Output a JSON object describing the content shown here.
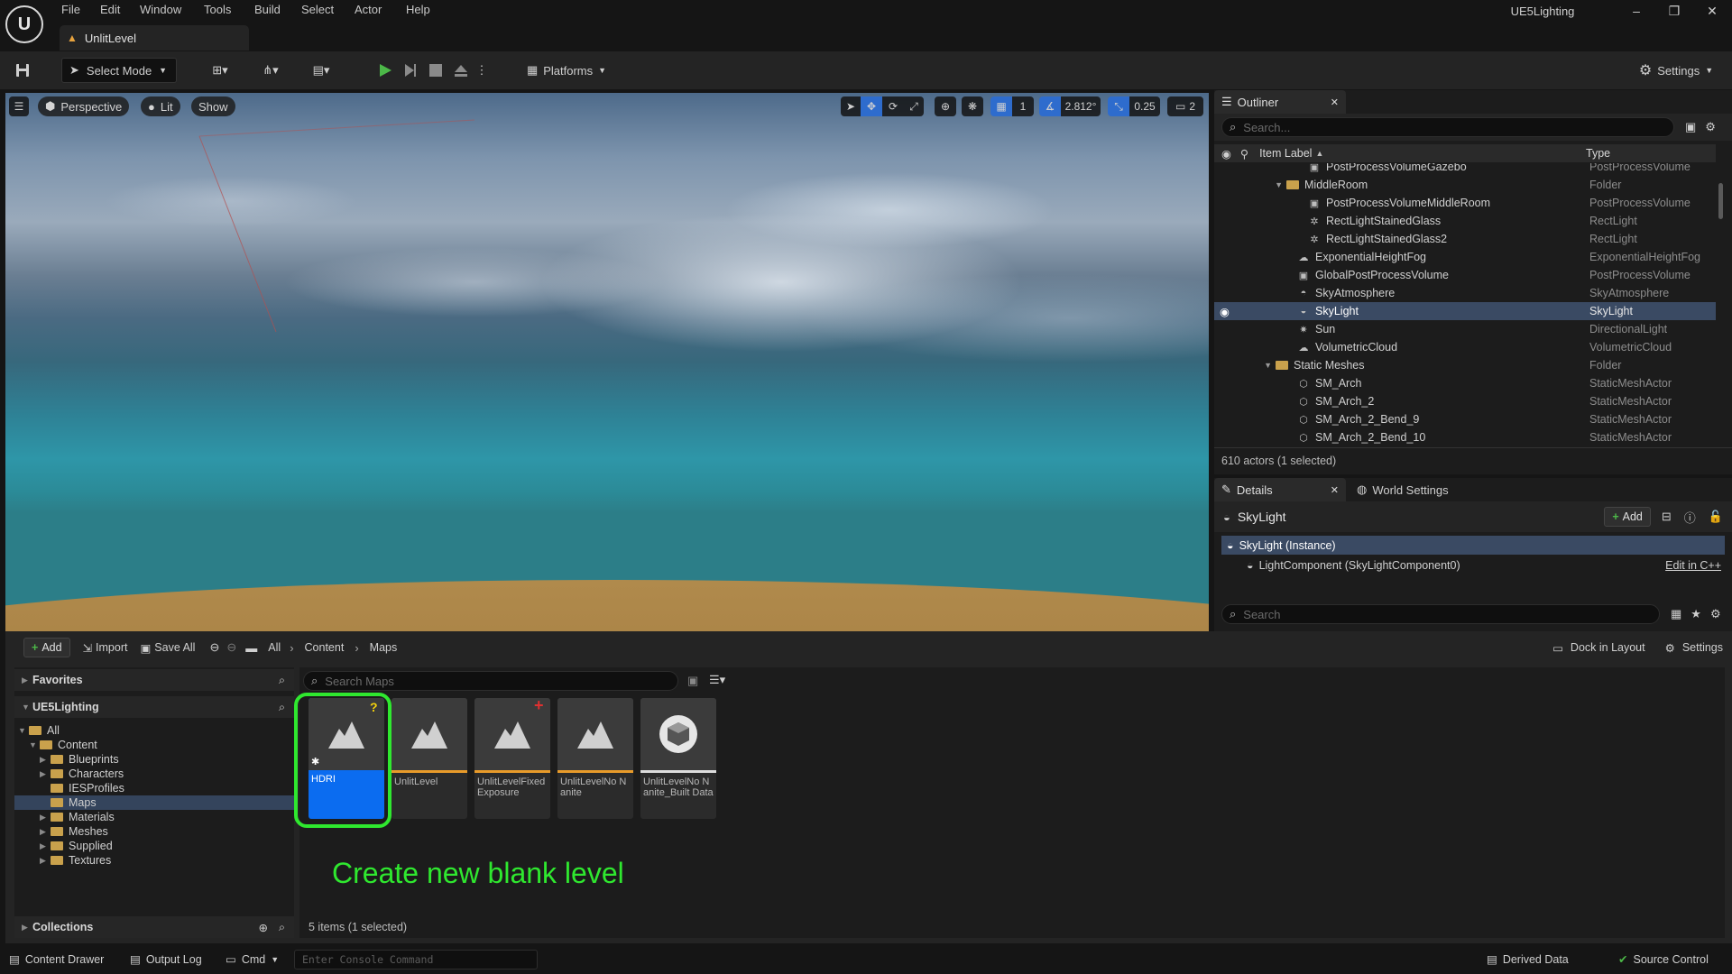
{
  "menu": [
    "File",
    "Edit",
    "Window",
    "Tools",
    "Build",
    "Select",
    "Actor",
    "Help"
  ],
  "level_tab": "UnlitLevel",
  "project_name": "UE5Lighting",
  "toolbar": {
    "select_mode": "Select Mode",
    "platforms": "Platforms",
    "settings": "Settings"
  },
  "viewport": {
    "perspective": "Perspective",
    "lit": "Lit",
    "show": "Show",
    "grid_value": "1",
    "angle_value": "2.812°",
    "scale_value": "0.25",
    "camera_speed": "2"
  },
  "outliner": {
    "title": "Outliner",
    "search_placeholder": "Search...",
    "col_label": "Item Label",
    "col_type": "Type",
    "rows": [
      {
        "label": "PostProcessVolumeGazebo",
        "type": "PostProcessVolume"
      },
      {
        "label": "MiddleRoom",
        "type": "Folder"
      },
      {
        "label": "PostProcessVolumeMiddleRoom",
        "type": "PostProcessVolume"
      },
      {
        "label": "RectLightStainedGlass",
        "type": "RectLight"
      },
      {
        "label": "RectLightStainedGlass2",
        "type": "RectLight"
      },
      {
        "label": "ExponentialHeightFog",
        "type": "ExponentialHeightFog"
      },
      {
        "label": "GlobalPostProcessVolume",
        "type": "PostProcessVolume"
      },
      {
        "label": "SkyAtmosphere",
        "type": "SkyAtmosphere"
      },
      {
        "label": "SkyLight",
        "type": "SkyLight"
      },
      {
        "label": "Sun",
        "type": "DirectionalLight"
      },
      {
        "label": "VolumetricCloud",
        "type": "VolumetricCloud"
      },
      {
        "label": "Static Meshes",
        "type": "Folder"
      },
      {
        "label": "SM_Arch",
        "type": "StaticMeshActor"
      },
      {
        "label": "SM_Arch_2",
        "type": "StaticMeshActor"
      },
      {
        "label": "SM_Arch_2_Bend_9",
        "type": "StaticMeshActor"
      },
      {
        "label": "SM_Arch_2_Bend_10",
        "type": "StaticMeshActor"
      }
    ],
    "footer": "610 actors (1 selected)"
  },
  "details": {
    "tab": "Details",
    "world_settings": "World Settings",
    "actor_name": "SkyLight",
    "add_label": "Add",
    "instance": "SkyLight (Instance)",
    "component": "LightComponent (SkyLightComponent0)",
    "edit_cpp": "Edit in C++",
    "search_placeholder": "Search"
  },
  "content_browser": {
    "add": "Add",
    "import": "Import",
    "save_all": "Save All",
    "breadcrumb": [
      "All",
      "Content",
      "Maps"
    ],
    "dock": "Dock in Layout",
    "settings": "Settings",
    "favorites": "Favorites",
    "project": "UE5Lighting",
    "collections": "Collections",
    "tree": [
      {
        "label": "All",
        "depth": 0,
        "expanded": true
      },
      {
        "label": "Content",
        "depth": 1,
        "expanded": true
      },
      {
        "label": "Blueprints",
        "depth": 2,
        "expanded": false
      },
      {
        "label": "Characters",
        "depth": 2,
        "expanded": false
      },
      {
        "label": "IESProfiles",
        "depth": 2,
        "expanded": null
      },
      {
        "label": "Maps",
        "depth": 2,
        "expanded": null
      },
      {
        "label": "Materials",
        "depth": 2,
        "expanded": false
      },
      {
        "label": "Meshes",
        "depth": 2,
        "expanded": false
      },
      {
        "label": "Supplied",
        "depth": 2,
        "expanded": false
      },
      {
        "label": "Textures",
        "depth": 2,
        "expanded": false
      }
    ],
    "search_placeholder": "Search Maps",
    "assets": [
      {
        "name": "HDRI",
        "badge": "?"
      },
      {
        "name": "UnlitLevel",
        "badge": ""
      },
      {
        "name": "UnlitLevelFixed Exposure",
        "badge": "+"
      },
      {
        "name": "UnlitLevelNo Nanite",
        "badge": ""
      },
      {
        "name": "UnlitLevelNo Nanite_Built Data",
        "badge": ""
      }
    ],
    "annotation": "Create new blank level",
    "count": "5 items (1 selected)"
  },
  "statusbar": {
    "content_drawer": "Content Drawer",
    "output_log": "Output Log",
    "cmd": "Cmd",
    "console_placeholder": "Enter Console Command",
    "derived_data": "Derived Data",
    "source_control": "Source Control"
  },
  "colors": {
    "accent": "#0b6cf0",
    "annotation": "#2fe82f",
    "selection": "#3a4a63",
    "play": "#4cb848"
  }
}
